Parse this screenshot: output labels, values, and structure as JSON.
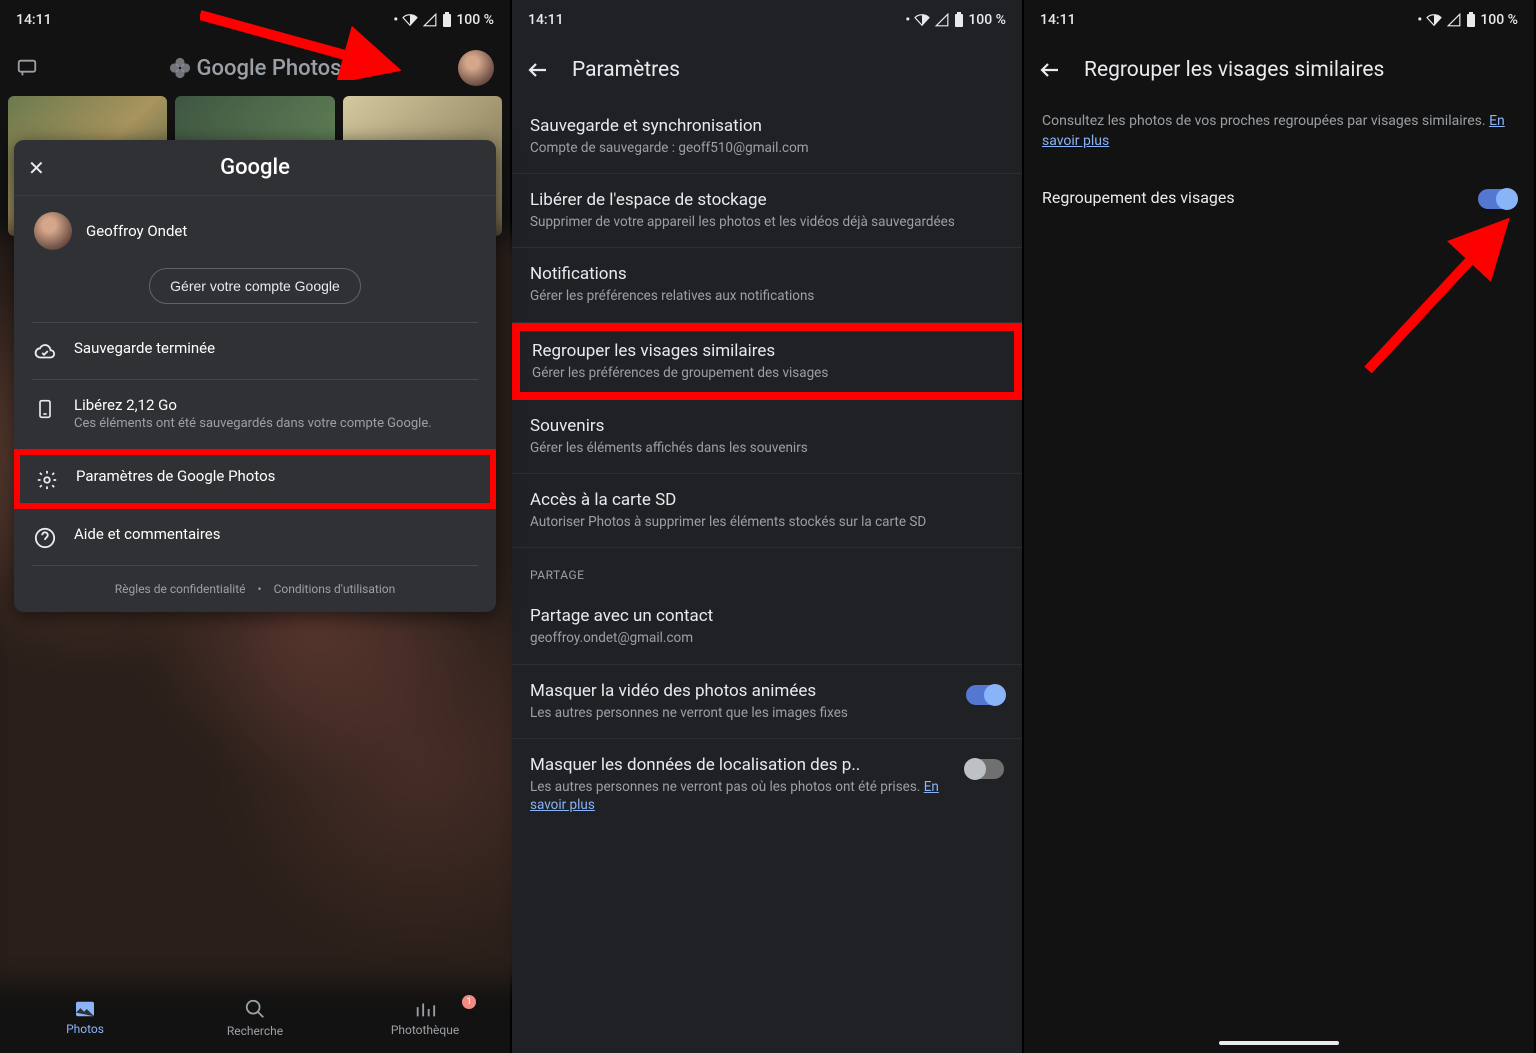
{
  "status": {
    "time": "14:11",
    "battery": "100 %"
  },
  "screen1": {
    "app_title": "Google Photos",
    "card": {
      "brand": "Google",
      "user_name": "Geoffroy Ondet",
      "manage_button": "Gérer votre compte Google",
      "backup_done": "Sauvegarde terminée",
      "free_title": "Libérez 2,12 Go",
      "free_sub": "Ces éléments ont été sauvegardés dans votre compte Google.",
      "settings_label": "Paramètres de Google Photos",
      "help_label": "Aide et commentaires",
      "privacy": "Règles de confidentialité",
      "dot": "•",
      "terms": "Conditions d'utilisation"
    },
    "nav": {
      "photos": "Photos",
      "search": "Recherche",
      "library": "Photothèque",
      "badge": "1"
    }
  },
  "screen2": {
    "title": "Paramètres",
    "items": {
      "backup_t": "Sauvegarde et synchronisation",
      "backup_s": "Compte de sauvegarde : geoff510@gmail.com",
      "free_t": "Libérer de l'espace de stockage",
      "free_s": "Supprimer de votre appareil les photos et les vidéos déjà sauvegardées",
      "notif_t": "Notifications",
      "notif_s": "Gérer les préférences relatives aux notifications",
      "faces_t": "Regrouper les visages similaires",
      "faces_s": "Gérer les préférences de groupement des visages",
      "souv_t": "Souvenirs",
      "souv_s": "Gérer les éléments affichés dans les souvenirs",
      "sd_t": "Accès à la carte SD",
      "sd_s": "Autoriser Photos à supprimer les éléments stockés sur la carte SD",
      "section_share": "PARTAGE",
      "share_t": "Partage avec un contact",
      "share_s": "geoffroy.ondet@gmail.com",
      "hidevid_t": "Masquer la vidéo des photos animées",
      "hidevid_s": "Les autres personnes ne verront que les images fixes",
      "hideloc_t": "Masquer les données de localisation des p..",
      "hideloc_s_a": "Les autres personnes ne verront pas où les photos ont été prises. ",
      "hideloc_link": "En savoir plus"
    }
  },
  "screen3": {
    "title": "Regrouper les visages similaires",
    "desc_a": "Consultez les photos de vos proches regroupées par visages similaires. ",
    "desc_link": "En savoir plus",
    "row_label": "Regroupement des visages"
  }
}
